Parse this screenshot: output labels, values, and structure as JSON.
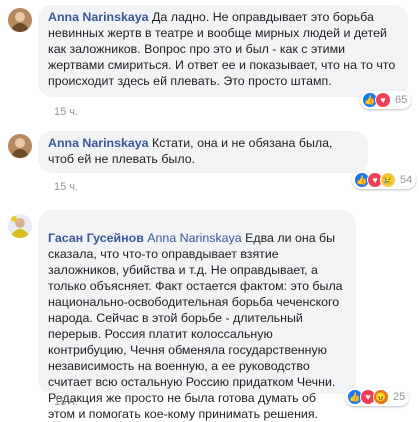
{
  "comments": [
    {
      "author": "Anna Narinskaya",
      "text": "Да ладно. Не оправдывает это борьба невинных жертв в театре и вообще мирных людей и детей как заложников. Вопрос про это и был - как с этими жертвами смириться. И ответ ее и показывает, что на то что происходит здесь ей плевать. Это просто штамп.",
      "time": "15 ч.",
      "reactions": [
        "like",
        "love"
      ],
      "reaction_count": "65"
    },
    {
      "author": "Anna Narinskaya",
      "text": "Кстати, она и не обязана была, чтоб ей не плевать было.",
      "time": "15 ч.",
      "reactions": [
        "like",
        "love",
        "sad"
      ],
      "reaction_count": "54"
    },
    {
      "author": "Гасан Гусейнов",
      "mention": "Anna Narinskaya",
      "text": "Едва ли она бы сказала, что что-то оправдывает взятие заложников, убийства и т.д. Не оправдывает, а только объясняет. Факт остается фактом: это была национально-освободительная борьба чеченского народа. Сейчас в этой борьбе - длительный перерыв. Россия платит колоссальную контрибуцию, Чечня обменяла государственную независимость на военную, а ее руководство считает всю остальную Россию придатком Чечни.\nРедакция же просто не была готова думать об этом и помогать кое-кому принимать решения.",
      "time": "15 ч.",
      "reactions": [
        "like",
        "love",
        "angry"
      ],
      "reaction_count": "25"
    }
  ],
  "reaction_icons": {
    "like": "👍",
    "love": "♥",
    "sad": "😢",
    "angry": "😠"
  },
  "colors": {
    "bubble": "#f2f3f5",
    "author": "#385898",
    "meta": "#90949c",
    "like": "#1877f2",
    "love": "#f33e58",
    "sad": "#f7c844",
    "angry": "#e9710f"
  }
}
